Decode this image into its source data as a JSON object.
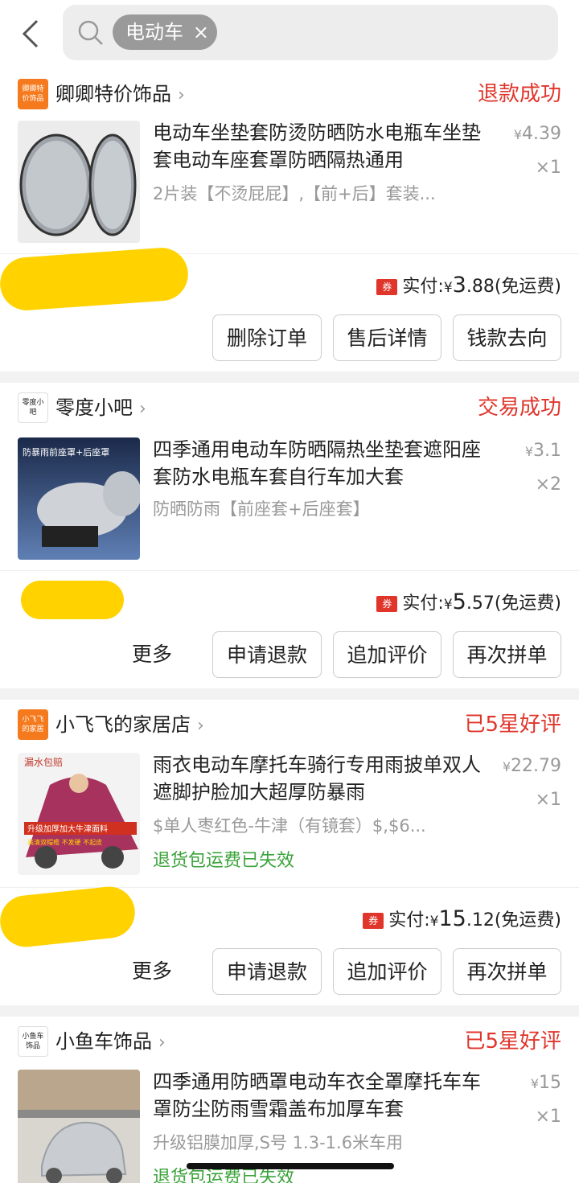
{
  "search": {
    "chip_label": "电动车",
    "chip_close": "×"
  },
  "orders": [
    {
      "shop": {
        "name": "卿卿特价饰品",
        "logo_text": "卿卿特价饰品",
        "logo_color": "#f57a1d"
      },
      "status": "退款成功",
      "title": "电动车坐垫套防烫防晒防水电瓶车坐垫套电动车座套罩防晒隔热通用",
      "sku": "2片装【不烫屁屁】,【前+后】套装...",
      "price": "4.39",
      "qty": "×1",
      "pay_label": "实付:",
      "pay_amount_int": "3",
      "pay_amount_dec": ".88",
      "pay_note": "(免运费)",
      "coupon": "券",
      "buttons": [
        "删除订单",
        "售后详情",
        "钱款去向"
      ]
    },
    {
      "shop": {
        "name": "零度小吧",
        "logo_text": "零度小吧",
        "logo_color": "#ffffff"
      },
      "status": "交易成功",
      "title": "四季通用电动车防晒隔热坐垫套遮阳座套防水电瓶车套自行车加大套",
      "sku": "防晒防雨【前座套+后座套】",
      "price": "3.1",
      "qty": "×2",
      "thumb_caption": "防暴雨前座罩+后座罩",
      "pay_label": "实付:",
      "pay_amount_int": "5",
      "pay_amount_dec": ".57",
      "pay_note": "(免运费)",
      "coupon": "券",
      "more": "更多",
      "buttons": [
        "申请退款",
        "追加评价",
        "再次拼单"
      ]
    },
    {
      "shop": {
        "name": "小飞飞的家居店",
        "logo_text": "小飞飞的家居",
        "logo_color": "#f57a1d"
      },
      "status": "已5星好评",
      "title": "雨衣电动车摩托车骑行专用雨披单双人遮脚护脸加大超厚防暴雨",
      "sku": "$单人枣红色-牛津（有镜套）$,$6...",
      "note": "退货包运费已失效",
      "price": "22.79",
      "qty": "×1",
      "thumb_caption_top": "漏水包赔",
      "thumb_caption_mid": "升级加厚加大牛津面料",
      "thumb_caption_bot": "高清双帽檐 不发硬 不起皮",
      "pay_label": "实付:",
      "pay_amount_int": "15",
      "pay_amount_dec": ".12",
      "pay_note": "(免运费)",
      "coupon": "券",
      "more": "更多",
      "buttons": [
        "申请退款",
        "追加评价",
        "再次拼单"
      ]
    },
    {
      "shop": {
        "name": "小鱼车饰品",
        "logo_text": "小鱼车饰品",
        "logo_color": "#ffffff"
      },
      "status": "已5星好评",
      "title": "四季通用防晒罩电动车衣全罩摩托车车罩防尘防雨雪霜盖布加厚车套",
      "sku": "升级铝膜加厚,S号 1.3-1.6米车用",
      "note": "退货包运费已失效",
      "price": "15",
      "qty": "×1"
    }
  ],
  "currency": "¥"
}
